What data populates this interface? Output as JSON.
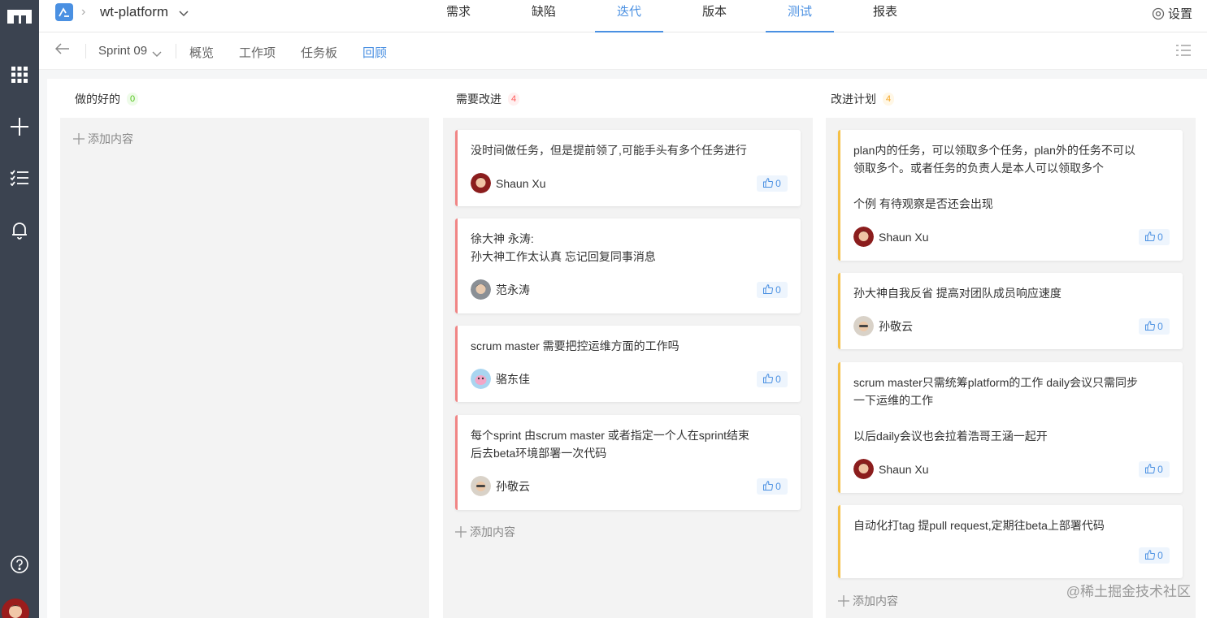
{
  "header": {
    "project": "wt-platform",
    "nav": [
      "需求",
      "缺陷",
      "迭代",
      "版本",
      "测试",
      "报表"
    ],
    "active_nav": [
      "迭代",
      "测试"
    ],
    "settings": "设置"
  },
  "subheader": {
    "sprint": "Sprint 09",
    "tabs": [
      "概览",
      "工作项",
      "任务板",
      "回顾"
    ],
    "active_tab": "回顾"
  },
  "columns": [
    {
      "title": "做的好的",
      "count": "0",
      "add_label": "添加内容",
      "cards": []
    },
    {
      "title": "需要改进",
      "count": "4",
      "add_label": "添加内容",
      "cards": [
        {
          "text": "没时间做任务，但是提前领了,可能手头有多个任务进行",
          "user": "Shaun Xu",
          "likes": "0"
        },
        {
          "text": "徐大神 永涛:\n孙大神工作太认真 忘记回复同事消息",
          "user": "范永涛",
          "likes": "0"
        },
        {
          "text": "scrum master 需要把控运维方面的工作吗",
          "user": "骆东佳",
          "likes": "0"
        },
        {
          "text": "每个sprint 由scrum master 或者指定一个人在sprint结束\n后去beta环境部署一次代码",
          "user": "孙敬云",
          "likes": "0"
        }
      ]
    },
    {
      "title": "改进计划",
      "count": "4",
      "add_label": "添加内容",
      "cards": [
        {
          "text": "plan内的任务，可以领取多个任务，plan外的任务不可以\n领取多个。或者任务的负责人是本人可以领取多个\n\n个例 有待观察是否还会出现",
          "user": "Shaun Xu",
          "likes": "0"
        },
        {
          "text": "孙大神自我反省 提高对团队成员响应速度",
          "user": "孙敬云",
          "likes": "0"
        },
        {
          "text": "scrum master只需统筹platform的工作 daily会议只需同步\n一下运维的工作\n\n以后daily会议也会拉着浩哥王涵一起开",
          "user": "Shaun Xu",
          "likes": "0"
        },
        {
          "text": "自动化打tag 提pull request,定期往beta上部署代码",
          "user": "",
          "likes": "0"
        }
      ]
    }
  ],
  "watermark": "@稀土掘金技术社区",
  "colors": {
    "accent": "#4a90e2",
    "improve": "#f08585",
    "plan": "#f5c046",
    "rail": "#3b4350"
  }
}
